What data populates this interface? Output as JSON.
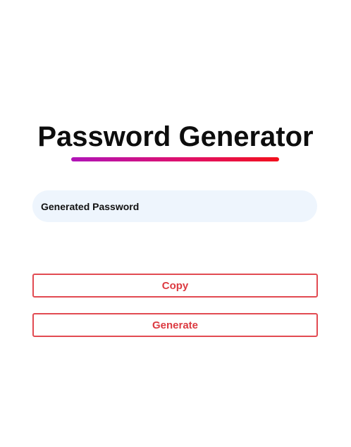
{
  "page": {
    "title": "Password Generator"
  },
  "password_field": {
    "placeholder": "Generated Password",
    "value": ""
  },
  "buttons": {
    "copy_label": "Copy",
    "generate_label": "Generate"
  },
  "colors": {
    "title_text": "#0d0d0d",
    "underline_gradient_start": "#b014b8",
    "underline_gradient_end": "#f2101c",
    "field_background": "#eef5fd",
    "button_accent": "#e24b52"
  }
}
